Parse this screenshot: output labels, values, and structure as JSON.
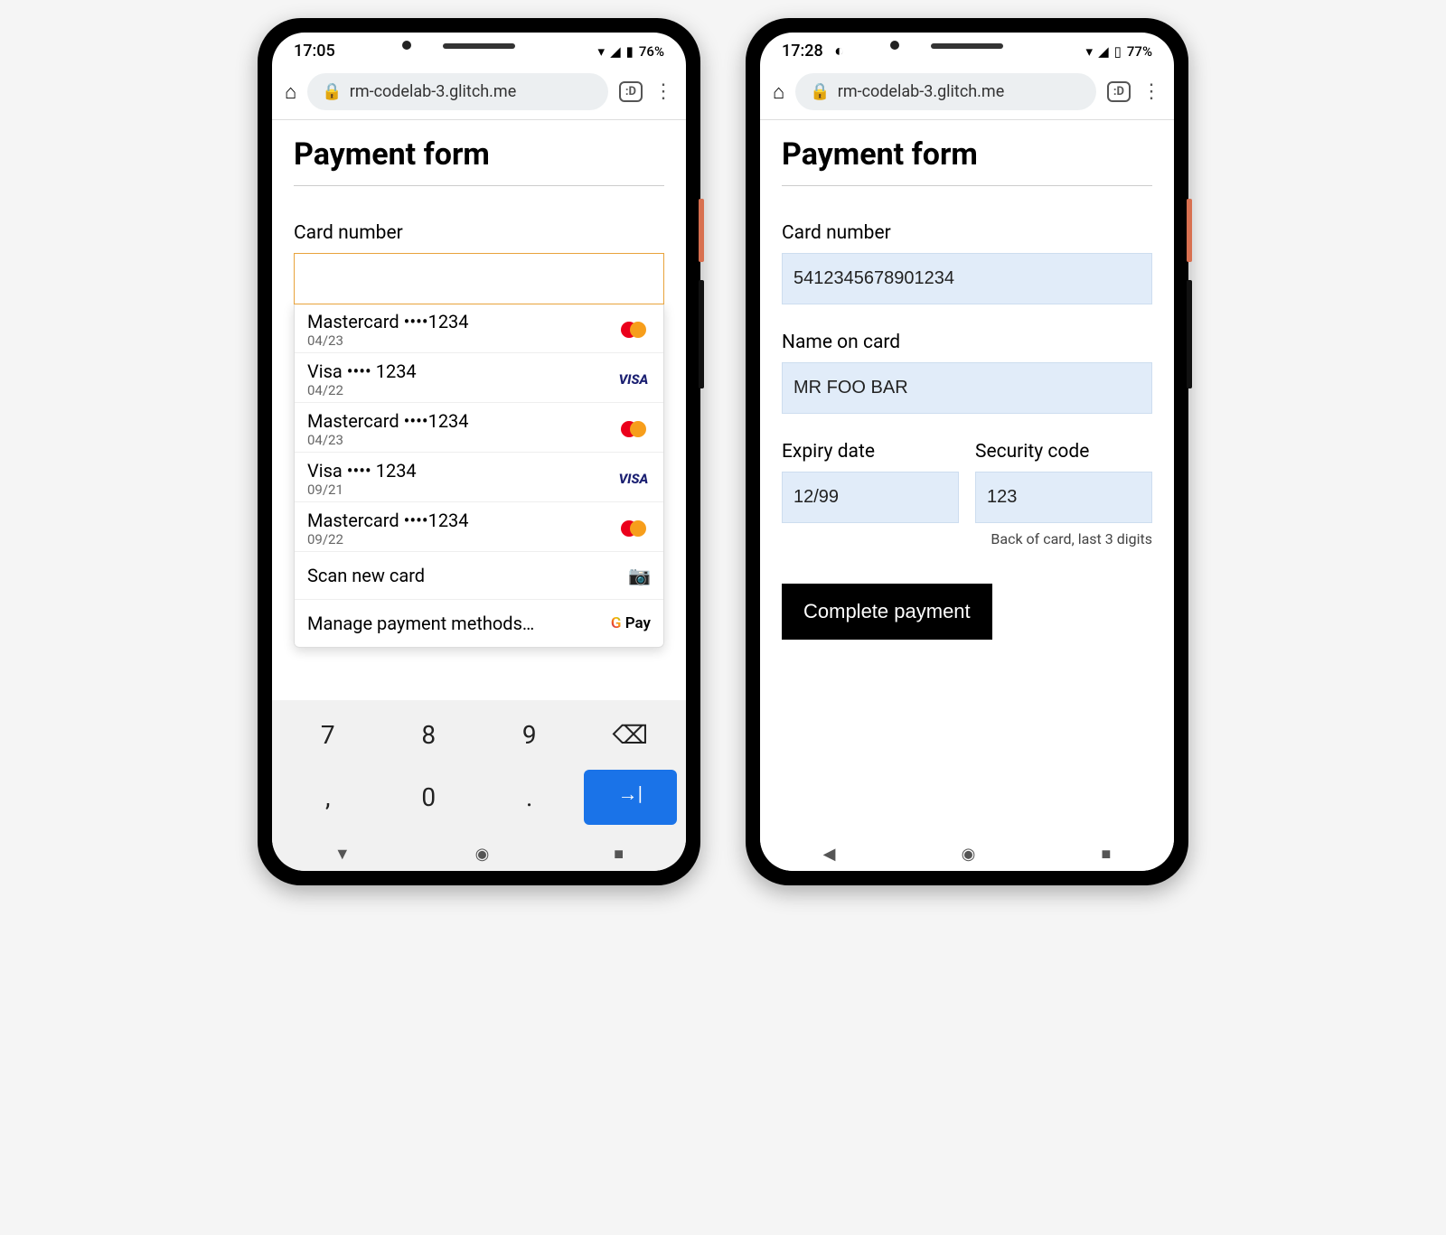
{
  "phone_left": {
    "status": {
      "time": "17:05",
      "battery": "76%"
    },
    "url": "rm-codelab-3.glitch.me",
    "tab_badge": ":D",
    "title": "Payment form",
    "card_number_label": "Card number",
    "card_number_value": "",
    "autofill_cards": [
      {
        "brand": "Mastercard",
        "mask": "••••1234",
        "exp": "04/23",
        "network": "mastercard"
      },
      {
        "brand": "Visa",
        "mask": "•••• 1234",
        "exp": "04/22",
        "network": "visa"
      },
      {
        "brand": "Mastercard",
        "mask": "••••1234",
        "exp": "04/23",
        "network": "mastercard"
      },
      {
        "brand": "Visa",
        "mask": "•••• 1234",
        "exp": "09/21",
        "network": "visa"
      },
      {
        "brand": "Mastercard",
        "mask": "••••1234",
        "exp": "09/22",
        "network": "mastercard"
      }
    ],
    "scan_new_card": "Scan new card",
    "manage_payment": "Manage payment methods…",
    "gpay_label": "Pay",
    "keyboard": {
      "row1": [
        "7",
        "8",
        "9",
        "⌫"
      ],
      "row2": [
        ",",
        "0",
        ".",
        "→|"
      ]
    }
  },
  "phone_right": {
    "status": {
      "time": "17:28",
      "battery": "77%"
    },
    "url": "rm-codelab-3.glitch.me",
    "tab_badge": ":D",
    "title": "Payment form",
    "card_number_label": "Card number",
    "card_number_value": "5412345678901234",
    "name_label": "Name on card",
    "name_value": "MR FOO BAR",
    "expiry_label": "Expiry date",
    "expiry_value": "12/99",
    "cvc_label": "Security code",
    "cvc_value": "123",
    "cvc_hint": "Back of card, last 3 digits",
    "submit_label": "Complete payment"
  }
}
